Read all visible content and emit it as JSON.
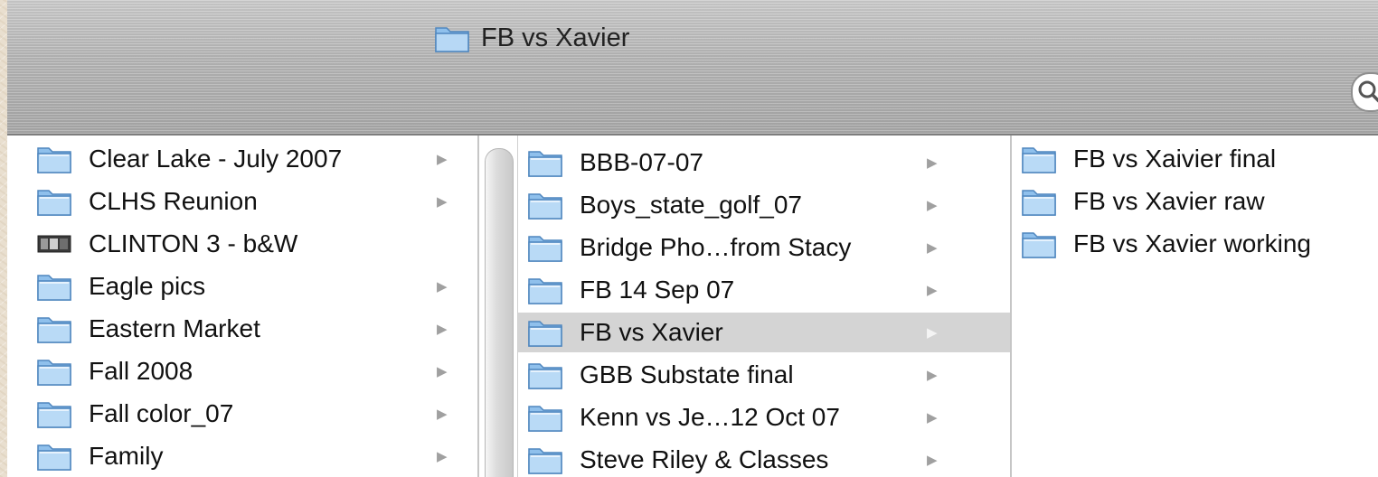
{
  "window": {
    "title": "FB vs Xavier",
    "title_icon": "folder-icon",
    "search_icon": "search-icon"
  },
  "columns": [
    {
      "items": [
        {
          "label": "Clear Lake - July 2007",
          "icon": "folder-icon",
          "has_children": true
        },
        {
          "label": "CLHS Reunion",
          "icon": "folder-icon",
          "has_children": true
        },
        {
          "label": "CLINTON 3 - b&W",
          "icon": "image-file-icon",
          "has_children": false
        },
        {
          "label": "Eagle pics",
          "icon": "folder-icon",
          "has_children": true
        },
        {
          "label": "Eastern Market",
          "icon": "folder-icon",
          "has_children": true
        },
        {
          "label": "Fall 2008",
          "icon": "folder-icon",
          "has_children": true
        },
        {
          "label": "Fall color_07",
          "icon": "folder-icon",
          "has_children": true
        },
        {
          "label": "Family",
          "icon": "folder-icon",
          "has_children": true
        }
      ]
    },
    {
      "items": [
        {
          "label": "BBB-07-07",
          "icon": "folder-icon",
          "has_children": true
        },
        {
          "label": "Boys_state_golf_07",
          "icon": "folder-icon",
          "has_children": true
        },
        {
          "label": "Bridge Pho…from Stacy",
          "icon": "folder-icon",
          "has_children": true
        },
        {
          "label": "FB 14 Sep 07",
          "icon": "folder-icon",
          "has_children": true
        },
        {
          "label": "FB vs Xavier",
          "icon": "folder-icon",
          "has_children": true,
          "selected": true
        },
        {
          "label": "GBB Substate final",
          "icon": "folder-icon",
          "has_children": true
        },
        {
          "label": "Kenn vs Je…12 Oct 07",
          "icon": "folder-icon",
          "has_children": true
        },
        {
          "label": "Steve Riley & Classes",
          "icon": "folder-icon",
          "has_children": true
        }
      ]
    },
    {
      "items": [
        {
          "label": "FB vs Xaivier final",
          "icon": "folder-icon"
        },
        {
          "label": "FB vs Xavier raw",
          "icon": "folder-icon"
        },
        {
          "label": "FB vs Xavier working",
          "icon": "folder-icon"
        }
      ]
    }
  ],
  "colors": {
    "selection": "#d4d4d4",
    "folder_blue": "#7fb4e6",
    "titlebar": "#b3b3b3"
  }
}
